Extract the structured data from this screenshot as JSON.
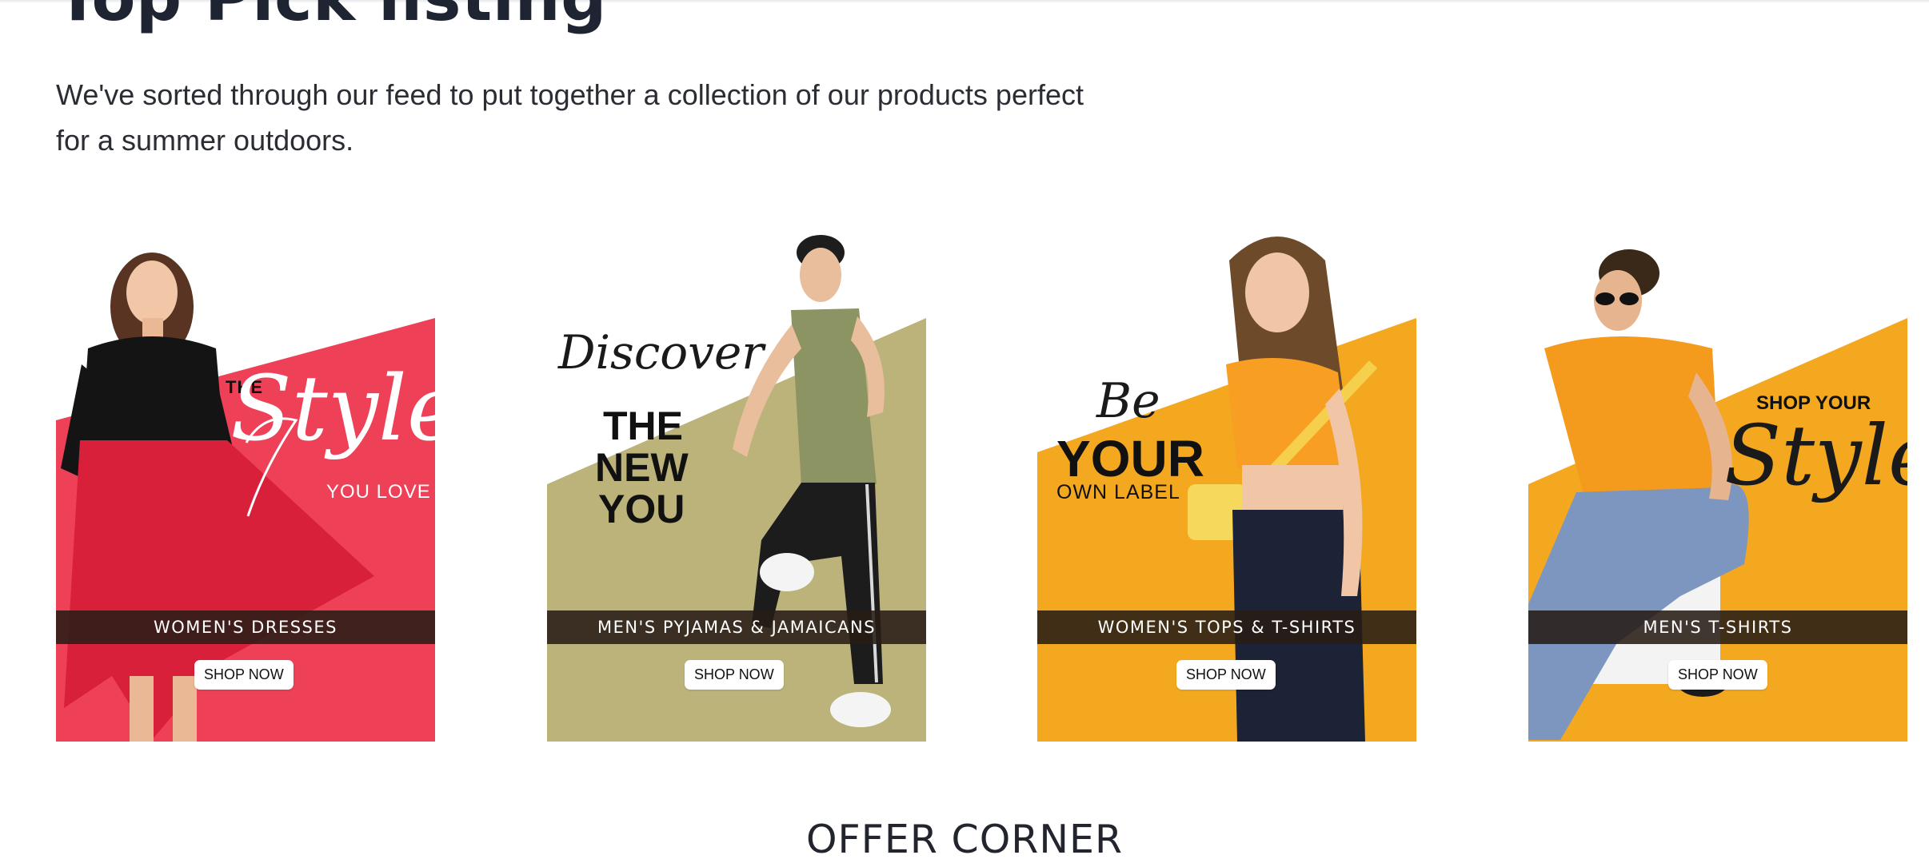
{
  "header": {
    "title": "Top Pick listing",
    "description": "We've sorted through our feed to put together a collection of our products perfect for a summer outdoors."
  },
  "cards": [
    {
      "headline_script": "Style",
      "headline_pre": "THE",
      "headline_post": "YOU LOVE",
      "category": "WOMEN'S DRESSES",
      "cta": "SHOP NOW",
      "accent_color": "#ee4056"
    },
    {
      "headline_script": "Discover",
      "headline_bold_1": "THE",
      "headline_bold_2": "NEW",
      "headline_bold_3": "YOU",
      "category": "MEN'S PYJAMAS & JAMAICANS",
      "cta": "SHOP NOW",
      "accent_color": "#bcb37a"
    },
    {
      "headline_script": "Be",
      "headline_bold": "YOUR",
      "headline_small": "OWN LABEL",
      "category": "WOMEN'S TOPS & T-SHIRTS",
      "cta": "SHOP NOW",
      "accent_color": "#f4a81f"
    },
    {
      "headline_small": "SHOP YOUR",
      "headline_script": "Style",
      "category": "MEN'S T-SHIRTS",
      "cta": "SHOP NOW",
      "accent_color": "#f4a81f"
    }
  ],
  "offer_section": {
    "title": "OFFER CORNER"
  }
}
